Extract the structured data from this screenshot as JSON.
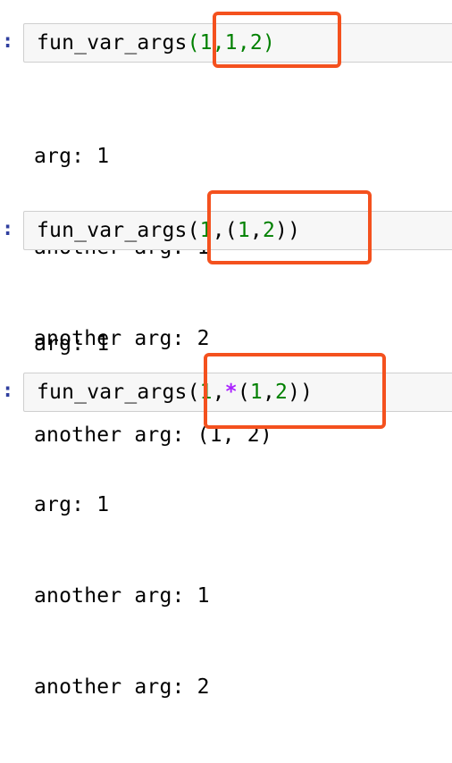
{
  "cells": [
    {
      "prompt": ":",
      "code": {
        "func": "fun_var_args",
        "open": "(",
        "a1": "1",
        "c1": ",",
        "a2": "1",
        "c2": ",",
        "a3": "2",
        "close": ")"
      },
      "output": [
        "arg: 1",
        "another arg: 1",
        "another arg: 2"
      ]
    },
    {
      "prompt": ":",
      "code": {
        "func": "fun_var_args",
        "open": "(",
        "a1": "1",
        "c1": ",",
        "open2": "(",
        "a2": "1",
        "c2": ",",
        "a3": "2",
        "close2": ")",
        "close": ")"
      },
      "output": [
        "arg: 1",
        "another arg: (1, 2)"
      ]
    },
    {
      "prompt": ":",
      "code": {
        "func": "fun_var_args",
        "open": "(",
        "a1": "1",
        "c1": ",",
        "star": "*",
        "open2": "(",
        "a2": "1",
        "c2": ",",
        "a3": "2",
        "close2": ")",
        "close": ")"
      },
      "output": [
        "arg: 1",
        "another arg: 1",
        "another arg: 2"
      ]
    }
  ],
  "colors": {
    "number": "#008000",
    "operator": "#aa22ff",
    "highlight": "#f4511e",
    "prompt": "#303f9f",
    "cell_background": "#f7f7f7"
  }
}
